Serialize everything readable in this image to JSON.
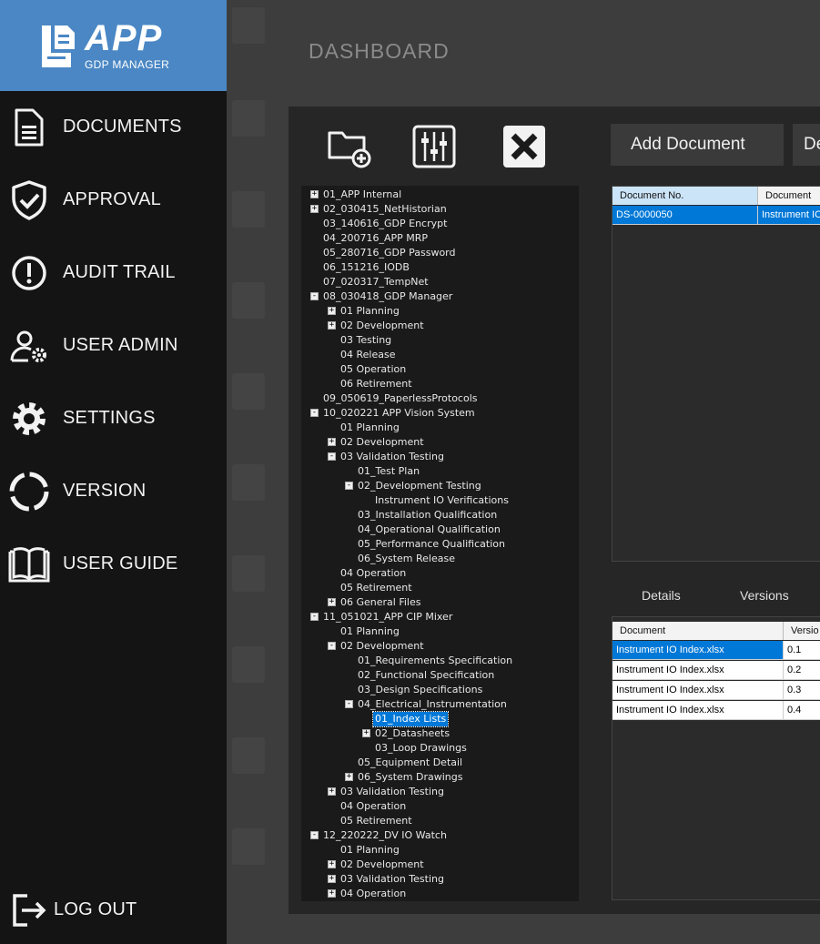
{
  "brand": {
    "name": "APP",
    "subtitle": "GDP MANAGER"
  },
  "nav": [
    {
      "label": "DOCUMENTS",
      "icon": "document-icon"
    },
    {
      "label": "APPROVAL",
      "icon": "shield-check-icon"
    },
    {
      "label": "AUDIT TRAIL",
      "icon": "alert-icon"
    },
    {
      "label": "USER ADMIN",
      "icon": "user-gear-icon"
    },
    {
      "label": "SETTINGS",
      "icon": "gear-icon"
    },
    {
      "label": "VERSION",
      "icon": "version-ring-icon"
    },
    {
      "label": "USER GUIDE",
      "icon": "book-icon"
    }
  ],
  "logout": {
    "label": "LOG OUT",
    "icon": "logout-icon"
  },
  "page_title": "DASHBOARD",
  "toolbar": {
    "add_document": "Add Document",
    "delete_document": "De"
  },
  "tree": [
    {
      "level": 0,
      "exp": "+",
      "label": "01_APP Internal"
    },
    {
      "level": 0,
      "exp": "+",
      "label": "02_030415_NetHistorian"
    },
    {
      "level": 0,
      "exp": "",
      "label": "03_140616_GDP Encrypt"
    },
    {
      "level": 0,
      "exp": "",
      "label": "04_200716_APP MRP"
    },
    {
      "level": 0,
      "exp": "",
      "label": "05_280716_GDP Password"
    },
    {
      "level": 0,
      "exp": "",
      "label": "06_151216_IODB"
    },
    {
      "level": 0,
      "exp": "",
      "label": "07_020317_TempNet"
    },
    {
      "level": 0,
      "exp": "-",
      "label": "08_030418_GDP Manager"
    },
    {
      "level": 1,
      "exp": "+",
      "label": "01 Planning"
    },
    {
      "level": 1,
      "exp": "+",
      "label": "02 Development"
    },
    {
      "level": 1,
      "exp": "",
      "label": "03 Testing"
    },
    {
      "level": 1,
      "exp": "",
      "label": "04 Release"
    },
    {
      "level": 1,
      "exp": "",
      "label": "05 Operation"
    },
    {
      "level": 1,
      "exp": "",
      "label": "06 Retirement"
    },
    {
      "level": 0,
      "exp": "",
      "label": "09_050619_PaperlessProtocols"
    },
    {
      "level": 0,
      "exp": "-",
      "label": "10_020221 APP Vision System"
    },
    {
      "level": 1,
      "exp": "",
      "label": "01 Planning"
    },
    {
      "level": 1,
      "exp": "+",
      "label": "02 Development"
    },
    {
      "level": 1,
      "exp": "-",
      "label": "03 Validation Testing"
    },
    {
      "level": 2,
      "exp": "",
      "label": "01_Test Plan"
    },
    {
      "level": 2,
      "exp": "-",
      "label": "02_Development Testing"
    },
    {
      "level": 3,
      "exp": "",
      "label": "Instrument IO Verifications"
    },
    {
      "level": 2,
      "exp": "",
      "label": "03_Installation Qualification"
    },
    {
      "level": 2,
      "exp": "",
      "label": "04_Operational Qualification"
    },
    {
      "level": 2,
      "exp": "",
      "label": "05_Performance Qualification"
    },
    {
      "level": 2,
      "exp": "",
      "label": "06_System Release"
    },
    {
      "level": 1,
      "exp": "",
      "label": "04 Operation"
    },
    {
      "level": 1,
      "exp": "",
      "label": "05 Retirement"
    },
    {
      "level": 1,
      "exp": "+",
      "label": "06 General Files"
    },
    {
      "level": 0,
      "exp": "-",
      "label": "11_051021_APP CIP Mixer"
    },
    {
      "level": 1,
      "exp": "",
      "label": "01 Planning"
    },
    {
      "level": 1,
      "exp": "-",
      "label": "02 Development"
    },
    {
      "level": 2,
      "exp": "",
      "label": "01_Requirements Specification"
    },
    {
      "level": 2,
      "exp": "",
      "label": "02_Functional Specification"
    },
    {
      "level": 2,
      "exp": "",
      "label": "03_Design Specifications"
    },
    {
      "level": 2,
      "exp": "-",
      "label": "04_Electrical_Instrumentation"
    },
    {
      "level": 3,
      "exp": "",
      "label": "01_Index Lists",
      "selected": true
    },
    {
      "level": 3,
      "exp": "+",
      "label": "02_Datasheets"
    },
    {
      "level": 3,
      "exp": "",
      "label": "03_Loop Drawings"
    },
    {
      "level": 2,
      "exp": "",
      "label": "05_Equipment Detail"
    },
    {
      "level": 2,
      "exp": "+",
      "label": "06_System Drawings"
    },
    {
      "level": 1,
      "exp": "+",
      "label": "03 Validation Testing"
    },
    {
      "level": 1,
      "exp": "",
      "label": "04 Operation"
    },
    {
      "level": 1,
      "exp": "",
      "label": "05 Retirement"
    },
    {
      "level": 0,
      "exp": "-",
      "label": "12_220222_DV IO Watch"
    },
    {
      "level": 1,
      "exp": "",
      "label": "01 Planning"
    },
    {
      "level": 1,
      "exp": "+",
      "label": "02 Development"
    },
    {
      "level": 1,
      "exp": "+",
      "label": "03 Validation Testing"
    },
    {
      "level": 1,
      "exp": "+",
      "label": "04 Operation"
    }
  ],
  "documents_grid": {
    "columns": [
      "Document No.",
      "Document"
    ],
    "rows": [
      [
        "DS-0000050",
        "Instrument IO"
      ]
    ]
  },
  "tabs": [
    "Details",
    "Versions"
  ],
  "versions_grid": {
    "columns": [
      "Document",
      "Versio"
    ],
    "rows": [
      [
        "Instrument IO Index.xlsx",
        "0.1"
      ],
      [
        "Instrument IO Index.xlsx",
        "0.2"
      ],
      [
        "Instrument IO Index.xlsx",
        "0.3"
      ],
      [
        "Instrument IO Index.xlsx",
        "0.4"
      ]
    ]
  },
  "colors": {
    "brand": "#4a87c4",
    "sidebar": "#141414",
    "selection": "#0078d7"
  }
}
